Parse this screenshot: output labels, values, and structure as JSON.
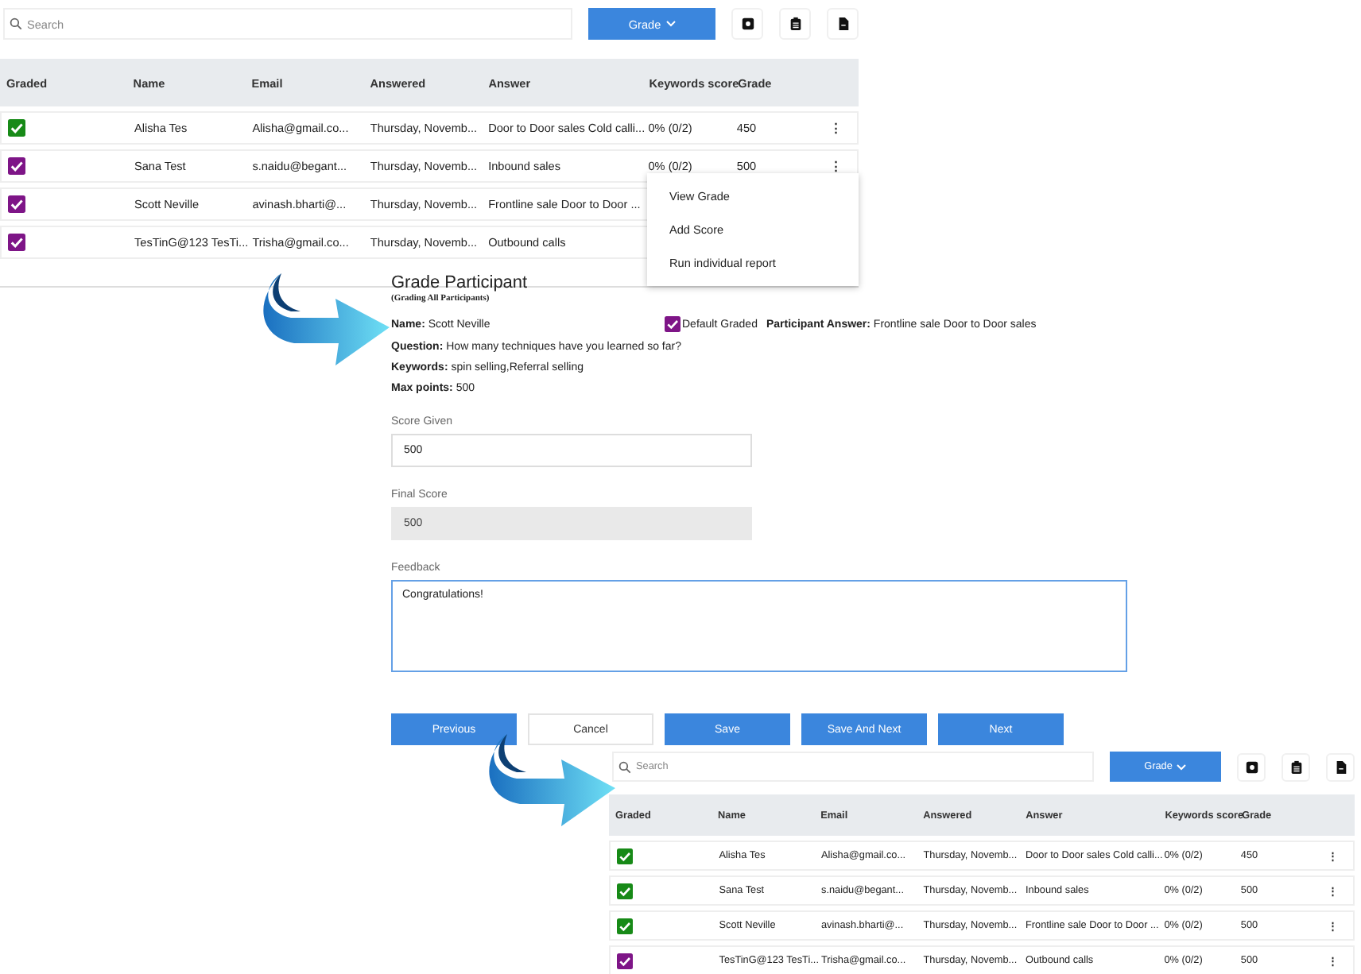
{
  "top_table": {
    "search": {
      "placeholder": "Search"
    },
    "grade_button": "Grade",
    "columns": [
      "Graded",
      "Name",
      "Email",
      "Answered",
      "Answer",
      "Keywords score",
      "Grade"
    ],
    "rows": [
      {
        "color": "#178a17",
        "name": "Alisha Tes",
        "email": "Alisha@gmail.co...",
        "answered": "Thursday, Novemb...",
        "answer": "Door to Door sales Cold calli...",
        "keywords_score": "0% (0/2)",
        "grade": "450",
        "actions": "⋮"
      },
      {
        "color": "#7e1587",
        "name": "Sana Test",
        "email": "s.naidu@begant...",
        "answered": "Thursday, Novemb...",
        "answer": "Inbound sales",
        "keywords_score": "0% (0/2)",
        "grade": "500",
        "actions": "⋮"
      },
      {
        "color": "#7e1587",
        "name": "Scott Neville",
        "email": "avinash.bharti@...",
        "answered": "Thursday, Novemb...",
        "answer": "Frontline sale Door to Door ..."
      },
      {
        "color": "#7e1587",
        "name": "TesTinG@123 TesTi...",
        "email": "Trisha@gmail.co...",
        "answered": "Thursday, Novemb...",
        "answer": "Outbound calls"
      }
    ],
    "context_menu": [
      "View Grade",
      "Add Score",
      "Run individual report"
    ]
  },
  "grade_form": {
    "title": "Grade Participant",
    "subtitle": "(Grading All Participants)",
    "name": "**Name:** Scott Neville",
    "default_graded": {
      "label": "Default Graded",
      "checked": true
    },
    "participant_answer": "**Participant Answer:** Frontline sale Door to Door sales",
    "details": [
      "**Question:** How many techniques have you learned so far?",
      "**Keywords:** spin selling,Referral selling",
      "**Max points:** 500"
    ],
    "fields": [
      {
        "label": "Score Given",
        "value": "500",
        "disabled": false
      },
      {
        "label": "Final Score",
        "value": "500",
        "disabled": true
      }
    ],
    "feedback": {
      "label": "Feedback",
      "value": "Congratulations!"
    },
    "buttons": [
      {
        "label": "Previous",
        "kind": "primary"
      },
      {
        "label": "Cancel",
        "kind": "secondary"
      },
      {
        "label": "Save",
        "kind": "primary"
      },
      {
        "label": "Save And Next",
        "kind": "primary"
      },
      {
        "label": "Next",
        "kind": "primary"
      }
    ]
  },
  "bottom_table": {
    "search": {
      "placeholder": "Search"
    },
    "grade_button": "Grade",
    "columns": [
      "Graded",
      "Name",
      "Email",
      "Answered",
      "Answer",
      "Keywords score",
      "Grade"
    ],
    "rows": [
      {
        "color": "#178a17",
        "name": "Alisha Tes",
        "email": "Alisha@gmail.co...",
        "answered": "Thursday, Novemb...",
        "answer": "Door to Door sales Cold calli...",
        "keywords_score": "0% (0/2)",
        "grade": "450",
        "actions": "⋮"
      },
      {
        "color": "#178a17",
        "name": "Sana Test",
        "email": "s.naidu@begant...",
        "answered": "Thursday, Novemb...",
        "answer": "Inbound sales",
        "keywords_score": "0% (0/2)",
        "grade": "500",
        "actions": "⋮"
      },
      {
        "color": "#178a17",
        "name": "Scott Neville",
        "email": "avinash.bharti@...",
        "answered": "Thursday, Novemb...",
        "answer": "Frontline sale Door to Door ...",
        "keywords_score": "0% (0/2)",
        "grade": "500",
        "actions": "⋮"
      },
      {
        "color": "#7e1587",
        "name": "TesTinG@123 TesTi...",
        "email": "Trisha@gmail.co...",
        "answered": "Thursday, Novemb...",
        "answer": "Outbound calls",
        "keywords_score": "0% (0/2)",
        "grade": "500",
        "actions": "⋮"
      }
    ]
  }
}
